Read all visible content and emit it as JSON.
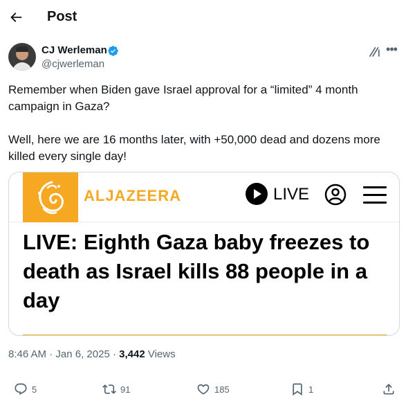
{
  "header": {
    "title": "Post"
  },
  "author": {
    "display_name": "CJ Werleman",
    "handle": "@cjwerleman"
  },
  "tweet": {
    "paragraphs": [
      "Remember when Biden gave Israel approval for a “limited” 4 month campaign in Gaza?",
      "Well, here we are 16 months later, with +50,000 dead and dozens more killed every single day!"
    ]
  },
  "card": {
    "brand": "ALJAZEERA",
    "live_label": "LIVE",
    "headline": "LIVE: Eighth Gaza baby freezes to death as Israel kills 88 people in a day"
  },
  "meta": {
    "time": "8:46 AM",
    "separator": " · ",
    "date": "Jan 6, 2025",
    "views_count": "3,442",
    "views_label": " Views"
  },
  "actions": {
    "replies": "5",
    "reposts": "91",
    "likes": "185",
    "bookmarks": "1"
  },
  "colors": {
    "text": "#0f1419",
    "secondary": "#536471",
    "verified": "#1d9bf0",
    "aj_gold": "#f7a823",
    "border": "#cfd9de"
  },
  "icons": [
    "back-arrow-icon",
    "verified-badge-icon",
    "grok-icon",
    "more-icon",
    "play-icon",
    "profile-icon",
    "menu-icon",
    "reply-icon",
    "repost-icon",
    "like-icon",
    "bookmark-icon",
    "share-icon"
  ]
}
